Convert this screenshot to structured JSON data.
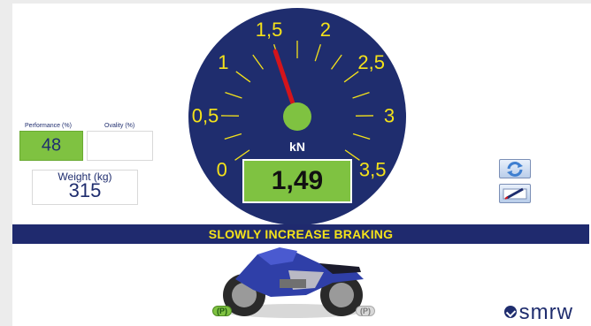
{
  "performance": {
    "label": "Performance (%)",
    "value": "48"
  },
  "ovality": {
    "label": "Ovality (%)",
    "value": ""
  },
  "weight": {
    "label": "Weight (kg)",
    "value": "315"
  },
  "gauge": {
    "unit": "kN",
    "reading": "1,49",
    "needle_value": 1.49,
    "range": [
      0,
      3.5
    ],
    "scale_labels": [
      "0",
      "0,5",
      "1",
      "1,5",
      "2",
      "2,5",
      "3",
      "3,5"
    ],
    "dial_color": "#1f2d6e",
    "label_color": "#f4e21a",
    "needle_color": "#d4141b",
    "hub_color": "#7fc241"
  },
  "banner": {
    "message": "SLOWLY INCREASE BRAKING"
  },
  "buttons": {
    "refresh_icon": "refresh-icon",
    "edit_icon": "edit-icon"
  },
  "motorcycle": {
    "front_park": "(P)",
    "rear_park": "(P)"
  },
  "logo": {
    "text": "smrw"
  },
  "colors": {
    "accent_green": "#7fc241",
    "navy": "#1f2a6e",
    "yellow": "#f4e21a"
  }
}
